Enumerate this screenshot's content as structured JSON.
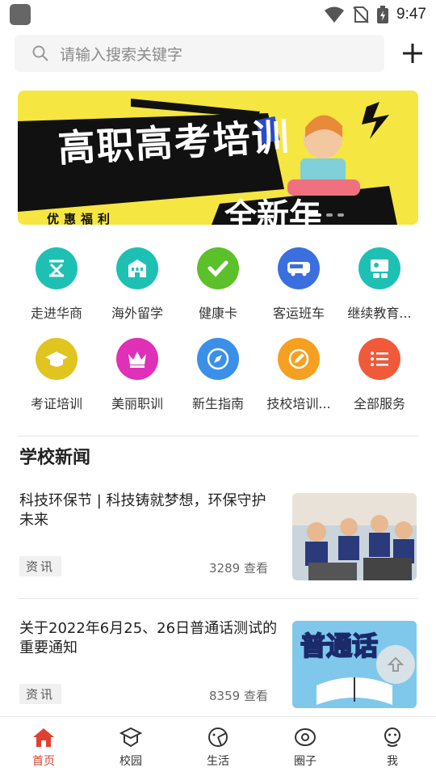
{
  "status": {
    "time": "9:47"
  },
  "search": {
    "placeholder": "请输入搜索关键字"
  },
  "banner": {
    "title": "高职高考培训",
    "subtitle": "优惠福利",
    "badge": "全新年"
  },
  "services": [
    {
      "label": "走进华商",
      "color": "#1fc0b4",
      "icon": "building-icon"
    },
    {
      "label": "海外留学",
      "color": "#1fc0b4",
      "icon": "school-icon"
    },
    {
      "label": "健康卡",
      "color": "#5cc02a",
      "icon": "check-icon"
    },
    {
      "label": "客运班车",
      "color": "#3b6fe0",
      "icon": "bus-icon"
    },
    {
      "label": "继续教育...",
      "color": "#1fc0b4",
      "icon": "teacher-icon"
    },
    {
      "label": "考证培训",
      "color": "#e0c420",
      "icon": "graduation-cap-icon"
    },
    {
      "label": "美丽职训",
      "color": "#e030b8",
      "icon": "crown-icon"
    },
    {
      "label": "新生指南",
      "color": "#3a8fe8",
      "icon": "compass-icon"
    },
    {
      "label": "技校培训...",
      "color": "#f5a020",
      "icon": "pen-icon"
    },
    {
      "label": "全部服务",
      "color": "#f05a3a",
      "icon": "list-icon"
    }
  ],
  "news_section": {
    "title": "学校新闻"
  },
  "news": [
    {
      "title": "科技环保节 | 科技铸就梦想，环保守护未来",
      "tag": "资讯",
      "views": "3289 查看"
    },
    {
      "title": "关于2022年6月25、26日普通话测试的重要通知",
      "tag": "资讯",
      "views": "8359 查看",
      "thumb_text": "普通话"
    }
  ],
  "nav": [
    {
      "label": "首页",
      "active": true
    },
    {
      "label": "校园"
    },
    {
      "label": "生活"
    },
    {
      "label": "圈子"
    },
    {
      "label": "我"
    }
  ],
  "colors": {
    "accent": "#e0402f",
    "banner_bg": "#f5e642"
  }
}
